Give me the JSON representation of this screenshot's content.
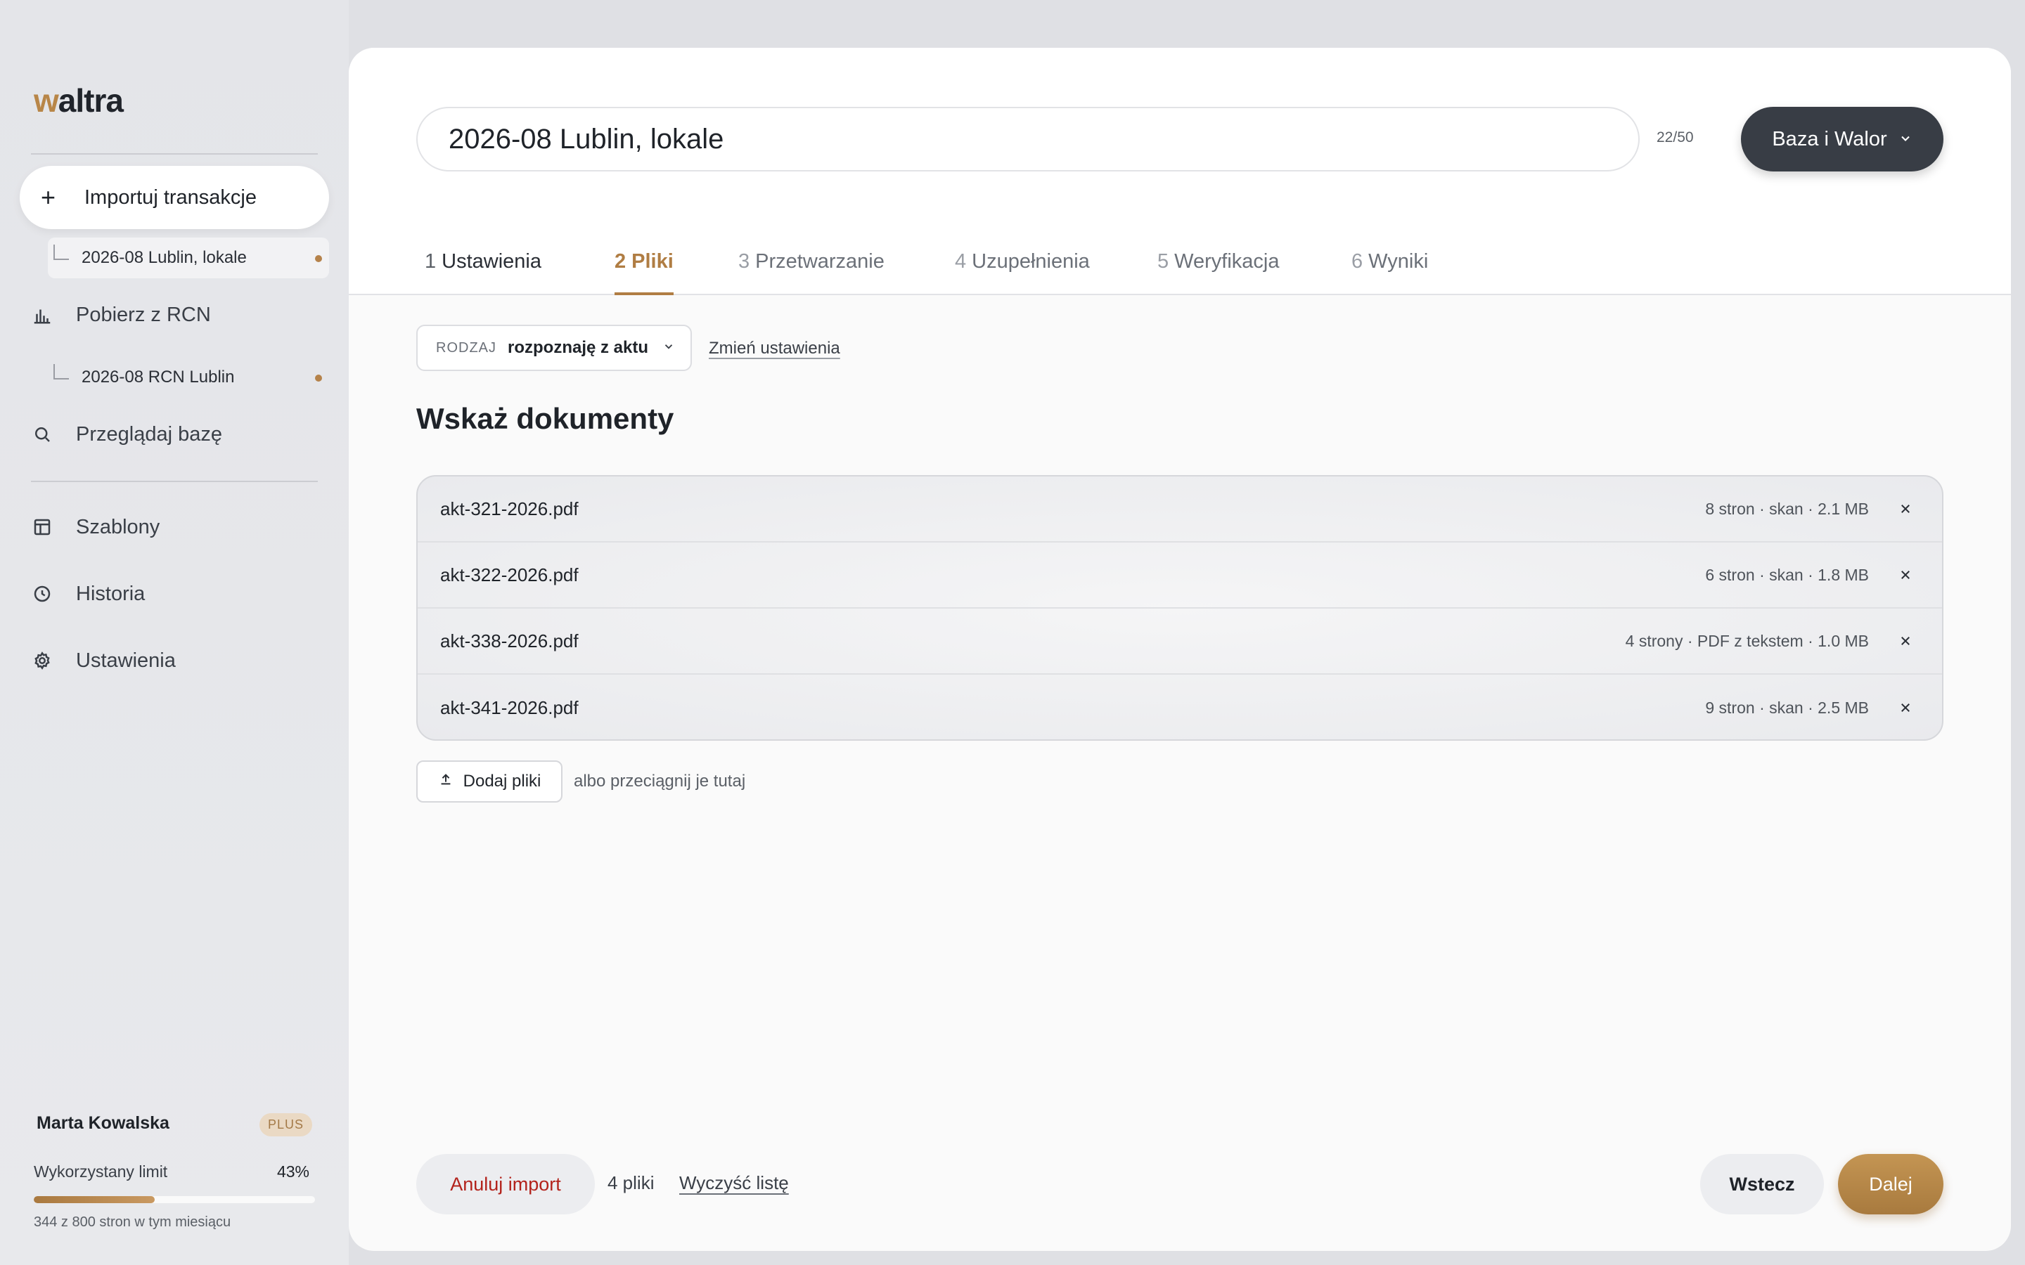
{
  "app": {
    "logo_accent": "w",
    "logo_rest": "altra"
  },
  "sidebar": {
    "import_label": "Importuj transakcje",
    "import_sub": "2026-08 Lublin, lokale",
    "rcn_label": "Pobierz z RCN",
    "rcn_sub": "2026-08 RCN Lublin",
    "browse_label": "Przeglądaj bazę",
    "templates_label": "Szablony",
    "history_label": "Historia",
    "settings_label": "Ustawienia"
  },
  "user": {
    "name": "Marta Kowalska",
    "plan": "PLUS",
    "limit_label": "Wykorzystany limit",
    "limit_pct_text": "43%",
    "limit_fraction": 0.43,
    "limit_note": "344 z 800 stron w tym miesiącu"
  },
  "header": {
    "title_value": "2026-08 Lublin, lokale",
    "char_count": "22/50",
    "org_label": "Baza i Walor"
  },
  "tabs": [
    {
      "num": "1",
      "label": "Ustawienia"
    },
    {
      "num": "2",
      "label": "Pliki"
    },
    {
      "num": "3",
      "label": "Przetwarzanie"
    },
    {
      "num": "4",
      "label": "Uzupełnienia"
    },
    {
      "num": "5",
      "label": "Weryfikacja"
    },
    {
      "num": "6",
      "label": "Wyniki"
    }
  ],
  "kind": {
    "label": "RODZAJ",
    "value": "rozpoznaję z aktu",
    "change_link": "Zmień ustawienia"
  },
  "section_title": "Wskaż dokumenty",
  "files": [
    {
      "name": "akt-321-2026.pdf",
      "meta": "8 stron · skan · 2.1 MB"
    },
    {
      "name": "akt-322-2026.pdf",
      "meta": "6 stron · skan · 1.8 MB"
    },
    {
      "name": "akt-338-2026.pdf",
      "meta": "4 strony · PDF z tekstem · 1.0 MB"
    },
    {
      "name": "akt-341-2026.pdf",
      "meta": "9 stron · skan · 2.5 MB"
    }
  ],
  "upload": {
    "add_label": "Dodaj pliki",
    "hint": "albo przeciągnij je tutaj"
  },
  "footer": {
    "cancel_label": "Anuluj import",
    "file_count": "4 pliki",
    "clear_label": "Wyczyść listę",
    "back_label": "Wstecz",
    "next_label": "Dalej"
  },
  "colors": {
    "accent": "#b07d43",
    "danger": "#b3231c",
    "dark_button": "#383d45"
  }
}
